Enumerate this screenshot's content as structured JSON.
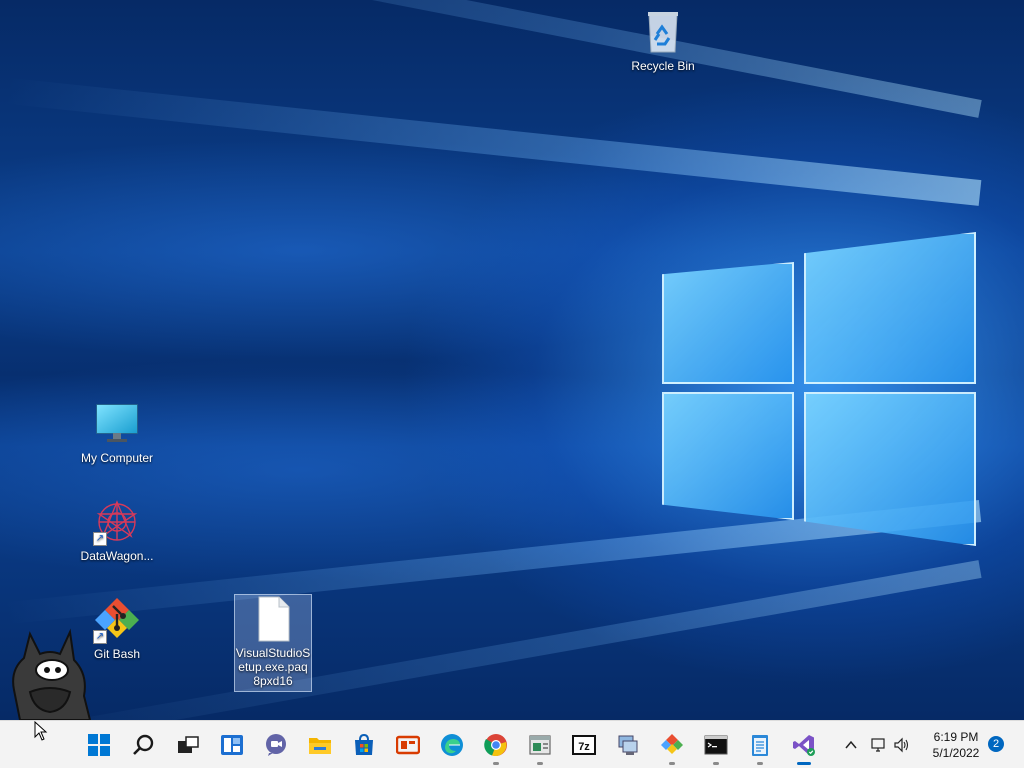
{
  "desktop": {
    "icons": [
      {
        "label": "Recycle Bin"
      },
      {
        "label": "My Computer"
      },
      {
        "label": "DataWagon..."
      },
      {
        "label": "Git Bash"
      },
      {
        "label": "VisualStudioSetup.exe.paq8pxd16"
      }
    ]
  },
  "taskbar": {
    "apps": [
      "Start",
      "Search",
      "Task View",
      "Widgets",
      "Chat",
      "File Explorer",
      "Microsoft Store",
      "Office",
      "Microsoft Edge",
      "Google Chrome",
      "Program",
      "7-Zip",
      "Network",
      "Git",
      "Terminal",
      "Notepad",
      "Visual Studio"
    ],
    "clock": {
      "time": "6:19 PM",
      "date": "5/1/2022"
    },
    "notifications": "2"
  },
  "colors": {
    "accent": "#0067c0",
    "taskbar_bg": "#f3f3f3"
  }
}
